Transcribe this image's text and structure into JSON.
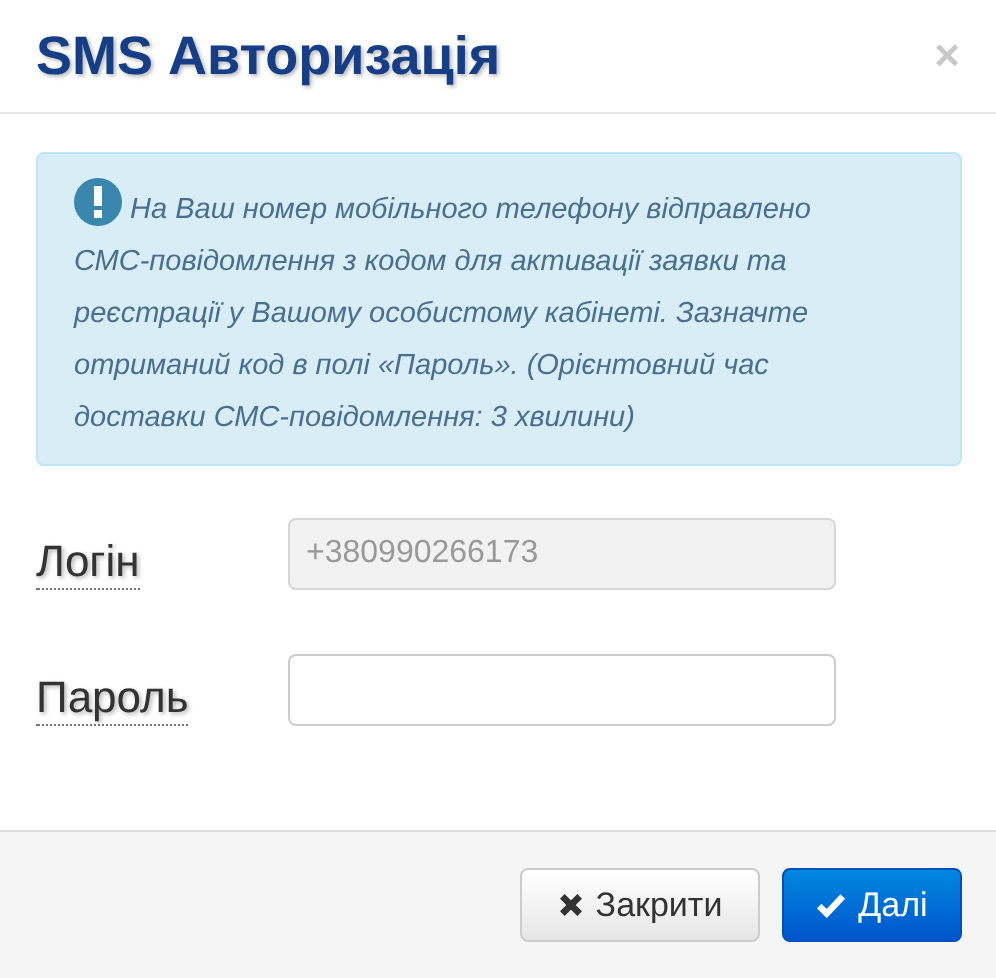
{
  "dialog": {
    "title": "SMS Авторизація",
    "close": "×"
  },
  "alert": {
    "text": "На Ваш номер мобільного телефону відправлено СМС-повідомлення з кодом для активації заявки та реєстрації у Вашому особистому кабінеті. Зазначте отриманий код в полі «Пароль». (Орієнтовний час доставки СМС-повідомлення: 3 хвилини)"
  },
  "fields": [
    {
      "label": "Логін",
      "value": "+380990266173",
      "readonly": true
    },
    {
      "label": "Пароль",
      "readonly": false
    }
  ],
  "buttons": [
    {
      "label": "Закрити",
      "kind": "close"
    },
    {
      "label": "Далі",
      "kind": "primary"
    }
  ]
}
